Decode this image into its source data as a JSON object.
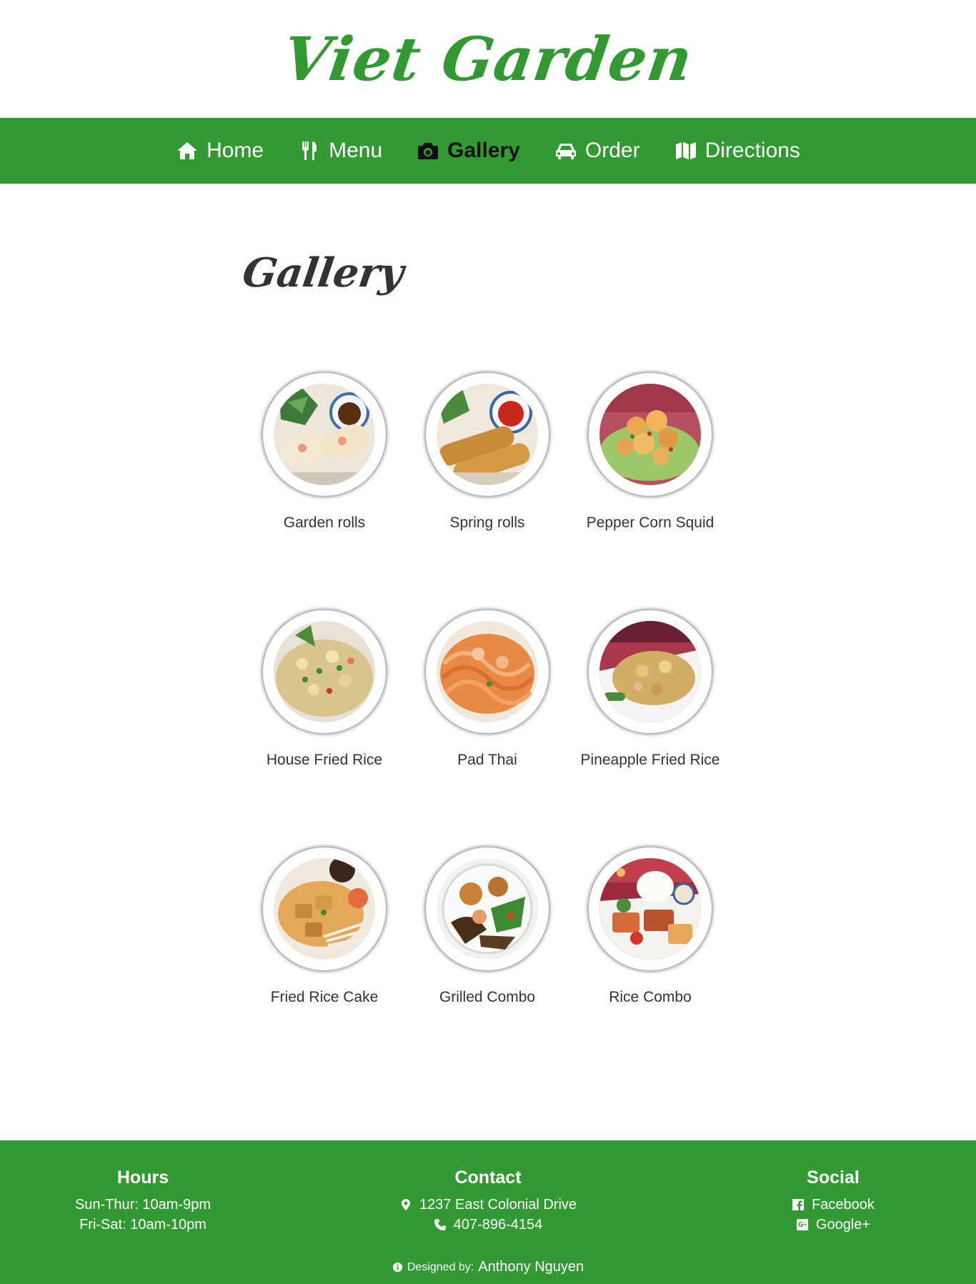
{
  "brand": {
    "title": "Viet Garden",
    "color": "#339933"
  },
  "nav": {
    "items": [
      {
        "label": "Home",
        "icon": "home-icon"
      },
      {
        "label": "Menu",
        "icon": "utensils-icon"
      },
      {
        "label": "Gallery",
        "icon": "camera-icon",
        "active": true
      },
      {
        "label": "Order",
        "icon": "car-icon"
      },
      {
        "label": "Directions",
        "icon": "map-icon"
      }
    ]
  },
  "gallery": {
    "title": "Gallery",
    "items": [
      {
        "caption": "Garden rolls"
      },
      {
        "caption": "Spring rolls"
      },
      {
        "caption": "Pepper Corn Squid"
      },
      {
        "caption": "House Fried Rice"
      },
      {
        "caption": "Pad Thai"
      },
      {
        "caption": "Pineapple Fried Rice"
      },
      {
        "caption": "Fried Rice Cake"
      },
      {
        "caption": "Grilled Combo"
      },
      {
        "caption": "Rice Combo"
      }
    ]
  },
  "footer": {
    "hours": {
      "title": "Hours",
      "lines": [
        "Sun-Thur: 10am-9pm",
        "Fri-Sat: 10am-10pm"
      ]
    },
    "contact": {
      "title": "Contact",
      "address": "1237 East Colonial Drive",
      "phone": "407-896-4154"
    },
    "social": {
      "title": "Social",
      "facebook": "Facebook",
      "google": "Google+"
    },
    "credit_prefix": "Designed by:",
    "credit_name": "Anthony Nguyen"
  },
  "colors": {
    "accent": "#339933",
    "text": "#333333",
    "active_nav": "#111111"
  }
}
